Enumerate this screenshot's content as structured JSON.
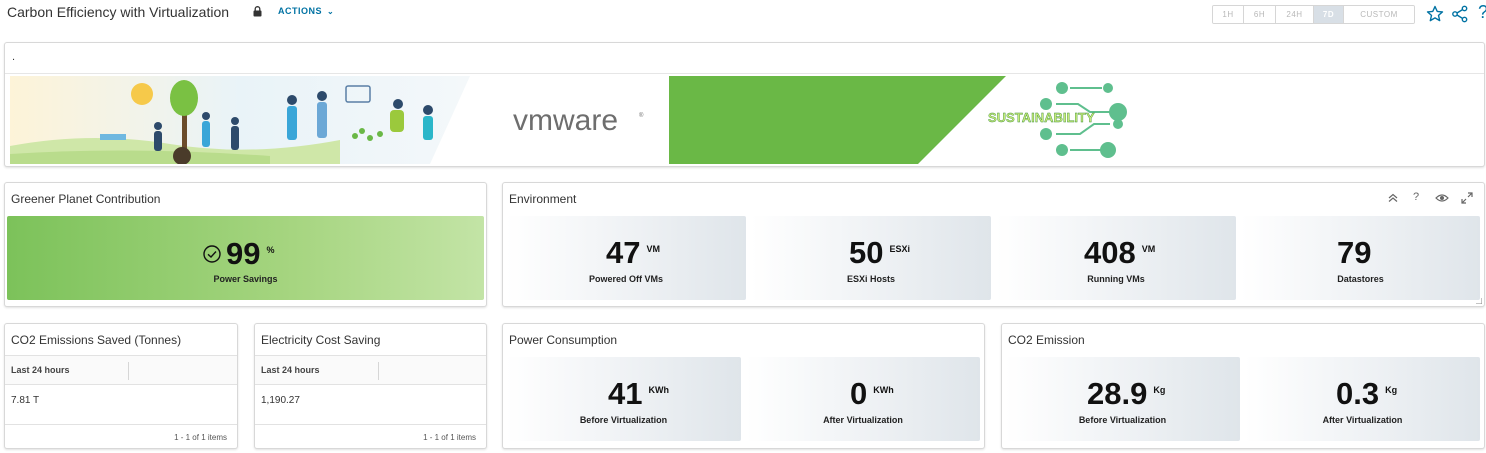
{
  "header": {
    "title": "Carbon Efficiency with Virtualization",
    "actions_label": "ACTIONS",
    "time_ranges": [
      "1H",
      "6H",
      "24H",
      "7D",
      "CUSTOM"
    ],
    "active_range": "7D"
  },
  "banner": {
    "dot": ".",
    "vmware_logo": "vmware",
    "sustainability_text": "SUSTAINABILITY"
  },
  "greener": {
    "title": "Greener Planet Contribution",
    "value": "99",
    "unit": "%",
    "label": "Power Savings"
  },
  "environment": {
    "title": "Environment",
    "metrics": [
      {
        "value": "47",
        "unit": "VM",
        "label": "Powered Off VMs"
      },
      {
        "value": "50",
        "unit": "ESXi",
        "label": "ESXi Hosts"
      },
      {
        "value": "408",
        "unit": "VM",
        "label": "Running VMs"
      },
      {
        "value": "79",
        "unit": "",
        "label": "Datastores"
      }
    ]
  },
  "co2_saved": {
    "title": "CO2 Emissions Saved (Tonnes)",
    "column": "Last 24 hours",
    "value": "7.81 T",
    "footer": "1 - 1 of 1 items"
  },
  "electricity": {
    "title": "Electricity Cost Saving",
    "column": "Last 24 hours",
    "value": "1,190.27",
    "footer": "1 - 1 of 1 items"
  },
  "power": {
    "title": "Power Consumption",
    "metrics": [
      {
        "value": "41",
        "unit": "KWh",
        "label": "Before Virtualization"
      },
      {
        "value": "0",
        "unit": "KWh",
        "label": "After Virtualization"
      }
    ]
  },
  "co2_emission": {
    "title": "CO2 Emission",
    "metrics": [
      {
        "value": "28.9",
        "unit": "Kg",
        "label": "Before Virtualization"
      },
      {
        "value": "0.3",
        "unit": "Kg",
        "label": "After Virtualization"
      }
    ]
  },
  "colors": {
    "accent": "#0072a3",
    "green": "#7cc25a",
    "banner_green": "#6ab846"
  }
}
